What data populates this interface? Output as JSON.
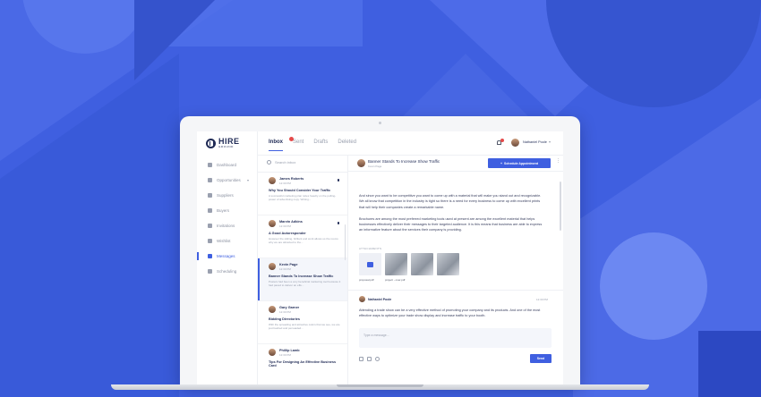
{
  "colors": {
    "background": "#3f5fe0",
    "accent": "#3f5fe0",
    "badge": "#e54a4a",
    "text_dark": "#1f2a55"
  },
  "logo": {
    "text": "HIRE",
    "sub": "GROUND"
  },
  "sidebar": {
    "items": [
      {
        "label": "Dashboard",
        "icon": "dashboard-icon"
      },
      {
        "label": "Opportunities",
        "icon": "briefcase-icon"
      },
      {
        "label": "Suppliers",
        "icon": "suppliers-icon"
      },
      {
        "label": "Buyers",
        "icon": "buyers-icon"
      },
      {
        "label": "Invitations",
        "icon": "send-icon"
      },
      {
        "label": "Wishlist",
        "icon": "star-icon"
      },
      {
        "label": "Messages",
        "icon": "chat-icon"
      },
      {
        "label": "Scheduling",
        "icon": "calendar-icon"
      }
    ]
  },
  "tabs": [
    "Inbox",
    "Sent",
    "Drafts",
    "Deleted"
  ],
  "header": {
    "user_name": "Nathaniel Poole"
  },
  "list": {
    "search_placeholder": "Search inbox",
    "threads": [
      {
        "name": "James Roberts",
        "time": "12:30 PM",
        "subject": "Why You Should Consider Your Traffic",
        "preview": "A successful marketing plan relies heavily on the pulling-power of advertising copy. Writing..."
      },
      {
        "name": "Marvin Adkins",
        "time": "12:30 PM",
        "subject": "A Good Autoresponder",
        "preview": "However the sliding, brilliant and work allows us the rooms why we are attracted to the..."
      },
      {
        "name": "Kevin Page",
        "time": "12:30 PM",
        "subject": "Banner Stands To Increase Show Traffic",
        "preview": "Posters had been a very beneficial marketing tool because it had paved to deliver an effe..."
      },
      {
        "name": "Gary Garner",
        "time": "12:30 PM",
        "subject": "Bidding Directories",
        "preview": "With the spreading and attractive colors that we see, we are just bashed and persuaded..."
      },
      {
        "name": "Phillip Lamb",
        "time": "12:30 PM",
        "subject": "Tips For Designing An Effective Business Card",
        "preview": ""
      }
    ]
  },
  "detail": {
    "title": "Banner Stands To Increase Show Traffic",
    "sender": "Kevin Page",
    "schedule_label": "Schedule Appointment",
    "body": [
      "And since you want to be competitive you want to come up with a material that will make you stand out and recognizable. We all know that competition in the industry is tight so there is a need for every business to come up with excellent prints that will help their companies create a remarkable name.",
      "Brochures are among the most preferred marketing tools used at present are among the excellent material that helps businesses effectively deliver their messages to their targeted audience. It is this means that business are able to express an informative feature about the services their company is providing."
    ],
    "attachments_label": "ATTACHMENTS",
    "attachments": [
      {
        "name": "proposal.pdf",
        "kind": "file"
      },
      {
        "name": "project - over.pdf",
        "kind": "image"
      },
      {
        "name": "",
        "kind": "image"
      },
      {
        "name": "",
        "kind": "image"
      }
    ],
    "reply": {
      "name": "Nathaniel Poole",
      "time": "12:30 PM",
      "text": "Attending a trade show can be a very effective method of promoting your company and its products. And one of the most effective ways to optimize your trade show display and increase traffic to your booth."
    },
    "compose_placeholder": "Type a message...",
    "send_label": "Send"
  }
}
